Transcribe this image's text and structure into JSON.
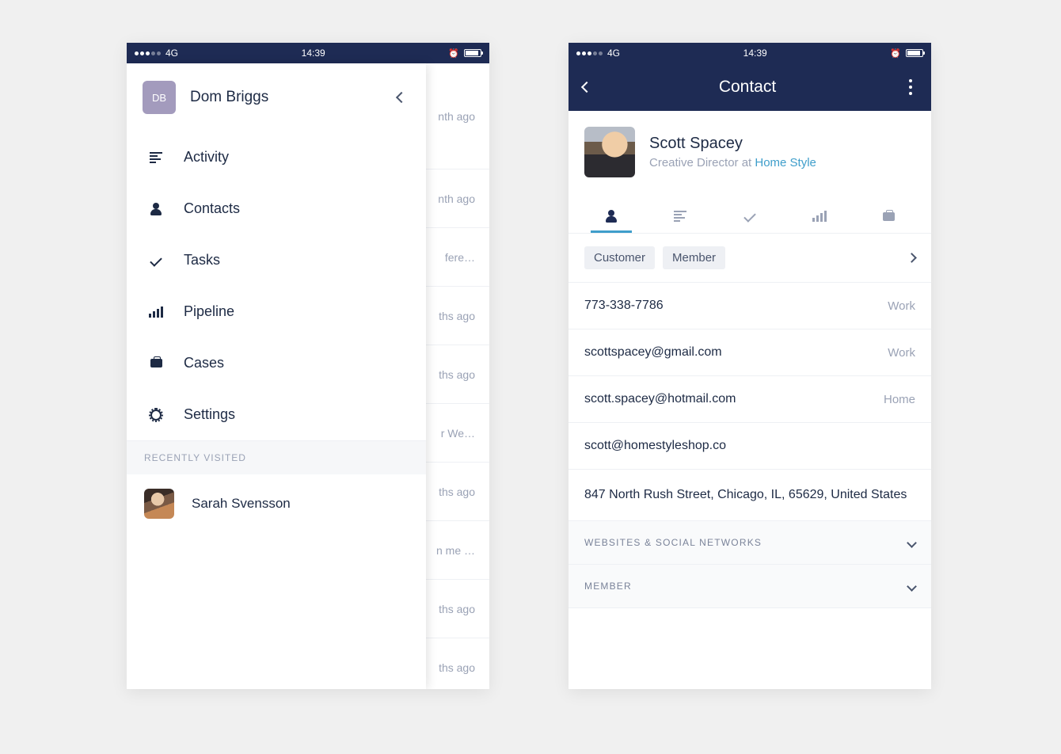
{
  "statusbar": {
    "network": "4G",
    "time": "14:39"
  },
  "left": {
    "user": {
      "initials": "DB",
      "name": "Dom Briggs"
    },
    "nav": {
      "activity": "Activity",
      "contacts": "Contacts",
      "tasks": "Tasks",
      "pipeline": "Pipeline",
      "cases": "Cases",
      "settings": "Settings"
    },
    "recently_visited_header": "RECENTLY VISITED",
    "recent": [
      {
        "name": "Sarah Svensson"
      }
    ],
    "background_rows": [
      "nth ago",
      "nth ago",
      "fere…",
      "ths ago",
      "ths ago",
      "r We…",
      "ths ago",
      "n me …",
      "ths ago",
      "ths ago"
    ]
  },
  "right": {
    "navbar_title": "Contact",
    "contact": {
      "name": "Scott Spacey",
      "role_prefix": "Creative Director at ",
      "company": "Home Style"
    },
    "tags": [
      "Customer",
      "Member"
    ],
    "details": [
      {
        "value": "773-338-7786",
        "label": "Work"
      },
      {
        "value": "scottspacey@gmail.com",
        "label": "Work"
      },
      {
        "value": "scott.spacey@hotmail.com",
        "label": "Home"
      },
      {
        "value": "scott@homestyleshop.co",
        "label": ""
      },
      {
        "value": "847 North Rush Street, Chicago, IL, 65629, United States",
        "label": ""
      }
    ],
    "sections": [
      "WEBSITES & SOCIAL NETWORKS",
      "MEMBER"
    ]
  }
}
